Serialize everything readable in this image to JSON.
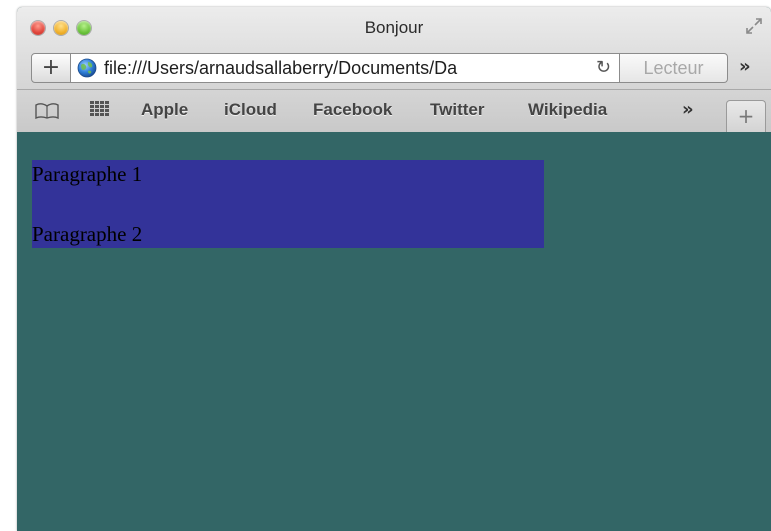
{
  "window": {
    "title": "Bonjour"
  },
  "toolbar": {
    "add_label": "+",
    "url": "file:///Users/arnaudsallaberry/Documents/Da",
    "reload_icon": "↻",
    "reader_label": "Lecteur",
    "more_label": "»"
  },
  "bookmarks": {
    "items": [
      {
        "label": "Apple"
      },
      {
        "label": "iCloud"
      },
      {
        "label": "Facebook"
      },
      {
        "label": "Twitter"
      },
      {
        "label": "Wikipedia"
      }
    ],
    "more_label": "»",
    "new_tab_label": "+"
  },
  "page": {
    "background": "#336666",
    "container_background": "#333399",
    "paragraphs": [
      {
        "text": "Paragraphe 1"
      },
      {
        "text": "Paragraphe 2"
      }
    ]
  }
}
